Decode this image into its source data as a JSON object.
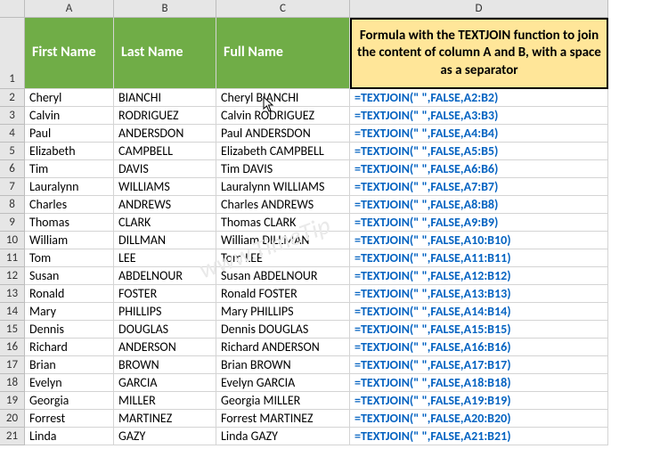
{
  "columns": [
    "A",
    "B",
    "C",
    "D"
  ],
  "header_row_num": "1",
  "headers": {
    "a": "First Name",
    "b": "Last Name",
    "c": "Full Name",
    "d": "Formula with the TEXTJOIN function to join the content of column A and B, with a space as a separator"
  },
  "rows": [
    {
      "n": "2",
      "a": "Cheryl",
      "b": "BIANCHI",
      "c": "Cheryl BIANCHI",
      "d": "=TEXTJOIN(\" \",FALSE,A2:B2)"
    },
    {
      "n": "3",
      "a": "Calvin",
      "b": "RODRIGUEZ",
      "c": "Calvin RODRIGUEZ",
      "d": "=TEXTJOIN(\" \",FALSE,A3:B3)"
    },
    {
      "n": "4",
      "a": "Paul",
      "b": "ANDERSDON",
      "c": "Paul ANDERSDON",
      "d": "=TEXTJOIN(\" \",FALSE,A4:B4)"
    },
    {
      "n": "5",
      "a": "Elizabeth",
      "b": "CAMPBELL",
      "c": "Elizabeth CAMPBELL",
      "d": "=TEXTJOIN(\" \",FALSE,A5:B5)"
    },
    {
      "n": "6",
      "a": "Tim",
      "b": "DAVIS",
      "c": "Tim DAVIS",
      "d": "=TEXTJOIN(\" \",FALSE,A6:B6)"
    },
    {
      "n": "7",
      "a": "Lauralynn",
      "b": "WILLIAMS",
      "c": "Lauralynn WILLIAMS",
      "d": "=TEXTJOIN(\" \",FALSE,A7:B7)"
    },
    {
      "n": "8",
      "a": "Charles",
      "b": "ANDREWS",
      "c": "Charles ANDREWS",
      "d": "=TEXTJOIN(\" \",FALSE,A8:B8)"
    },
    {
      "n": "9",
      "a": "Thomas",
      "b": "CLARK",
      "c": "Thomas CLARK",
      "d": "=TEXTJOIN(\" \",FALSE,A9:B9)"
    },
    {
      "n": "10",
      "a": "William",
      "b": "DILLMAN",
      "c": "William DILLMAN",
      "d": "=TEXTJOIN(\" \",FALSE,A10:B10)"
    },
    {
      "n": "11",
      "a": "Tom",
      "b": "LEE",
      "c": "Tom LEE",
      "d": "=TEXTJOIN(\" \",FALSE,A11:B11)"
    },
    {
      "n": "12",
      "a": "Susan",
      "b": "ABDELNOUR",
      "c": "Susan ABDELNOUR",
      "d": "=TEXTJOIN(\" \",FALSE,A12:B12)"
    },
    {
      "n": "13",
      "a": "Ronald",
      "b": "FOSTER",
      "c": "Ronald FOSTER",
      "d": "=TEXTJOIN(\" \",FALSE,A13:B13)"
    },
    {
      "n": "14",
      "a": "Mary",
      "b": "PHILLIPS",
      "c": "Mary PHILLIPS",
      "d": "=TEXTJOIN(\" \",FALSE,A14:B14)"
    },
    {
      "n": "15",
      "a": "Dennis",
      "b": "DOUGLAS",
      "c": "Dennis DOUGLAS",
      "d": "=TEXTJOIN(\" \",FALSE,A15:B15)"
    },
    {
      "n": "16",
      "a": "Richard",
      "b": "ANDERSON",
      "c": "Richard ANDERSON",
      "d": "=TEXTJOIN(\" \",FALSE,A16:B16)"
    },
    {
      "n": "17",
      "a": "Brian",
      "b": "BROWN",
      "c": "Brian BROWN",
      "d": "=TEXTJOIN(\" \",FALSE,A17:B17)"
    },
    {
      "n": "18",
      "a": "Evelyn",
      "b": "GARCIA",
      "c": "Evelyn GARCIA",
      "d": "=TEXTJOIN(\" \",FALSE,A18:B18)"
    },
    {
      "n": "19",
      "a": "Georgia",
      "b": "MILLER",
      "c": "Georgia MILLER",
      "d": "=TEXTJOIN(\" \",FALSE,A19:B19)"
    },
    {
      "n": "20",
      "a": "Forrest",
      "b": "MARTINEZ",
      "c": "Forrest MARTINEZ",
      "d": "=TEXTJOIN(\" \",FALSE,A20:B20)"
    },
    {
      "n": "21",
      "a": "Linda",
      "b": "GAZY",
      "c": "Linda GAZY",
      "d": "=TEXTJOIN(\" \",FALSE,A21:B21)"
    }
  ]
}
